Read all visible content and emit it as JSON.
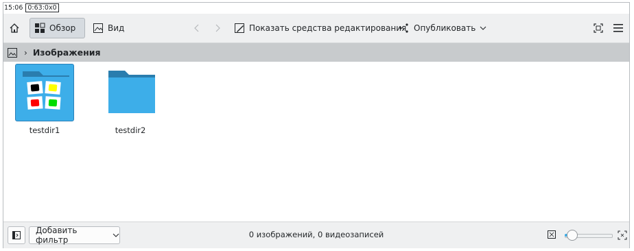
{
  "statusbar": {
    "time": "15:06",
    "position": "0:63:0x0"
  },
  "toolbar": {
    "overview_label": "Обзор",
    "view_label": "Вид",
    "edit_tools_label": "Показать средства редактирования",
    "share_label": "Опубликовать",
    "icons": [
      "home-icon",
      "overview-grid-icon",
      "image-view-icon",
      "back-arrow-icon",
      "forward-arrow-icon",
      "edit-image-icon",
      "share-icon",
      "fullscreen-icon",
      "hamburger-menu-icon"
    ]
  },
  "breadcrumb": {
    "current": "Изображения"
  },
  "items": [
    {
      "name": "testdir1",
      "selected": true
    },
    {
      "name": "testdir2",
      "selected": false
    }
  ],
  "bottombar": {
    "add_filter_label": "Добавить фильтр",
    "summary": "0 изображений, 0 видеозаписей",
    "zoom_level": 0.05
  },
  "colors": {
    "accent": "#3daee9",
    "folder": "#3daee9",
    "folder_dark": "#2980b9",
    "breadcrumb_bg": "#c8cbcd"
  }
}
